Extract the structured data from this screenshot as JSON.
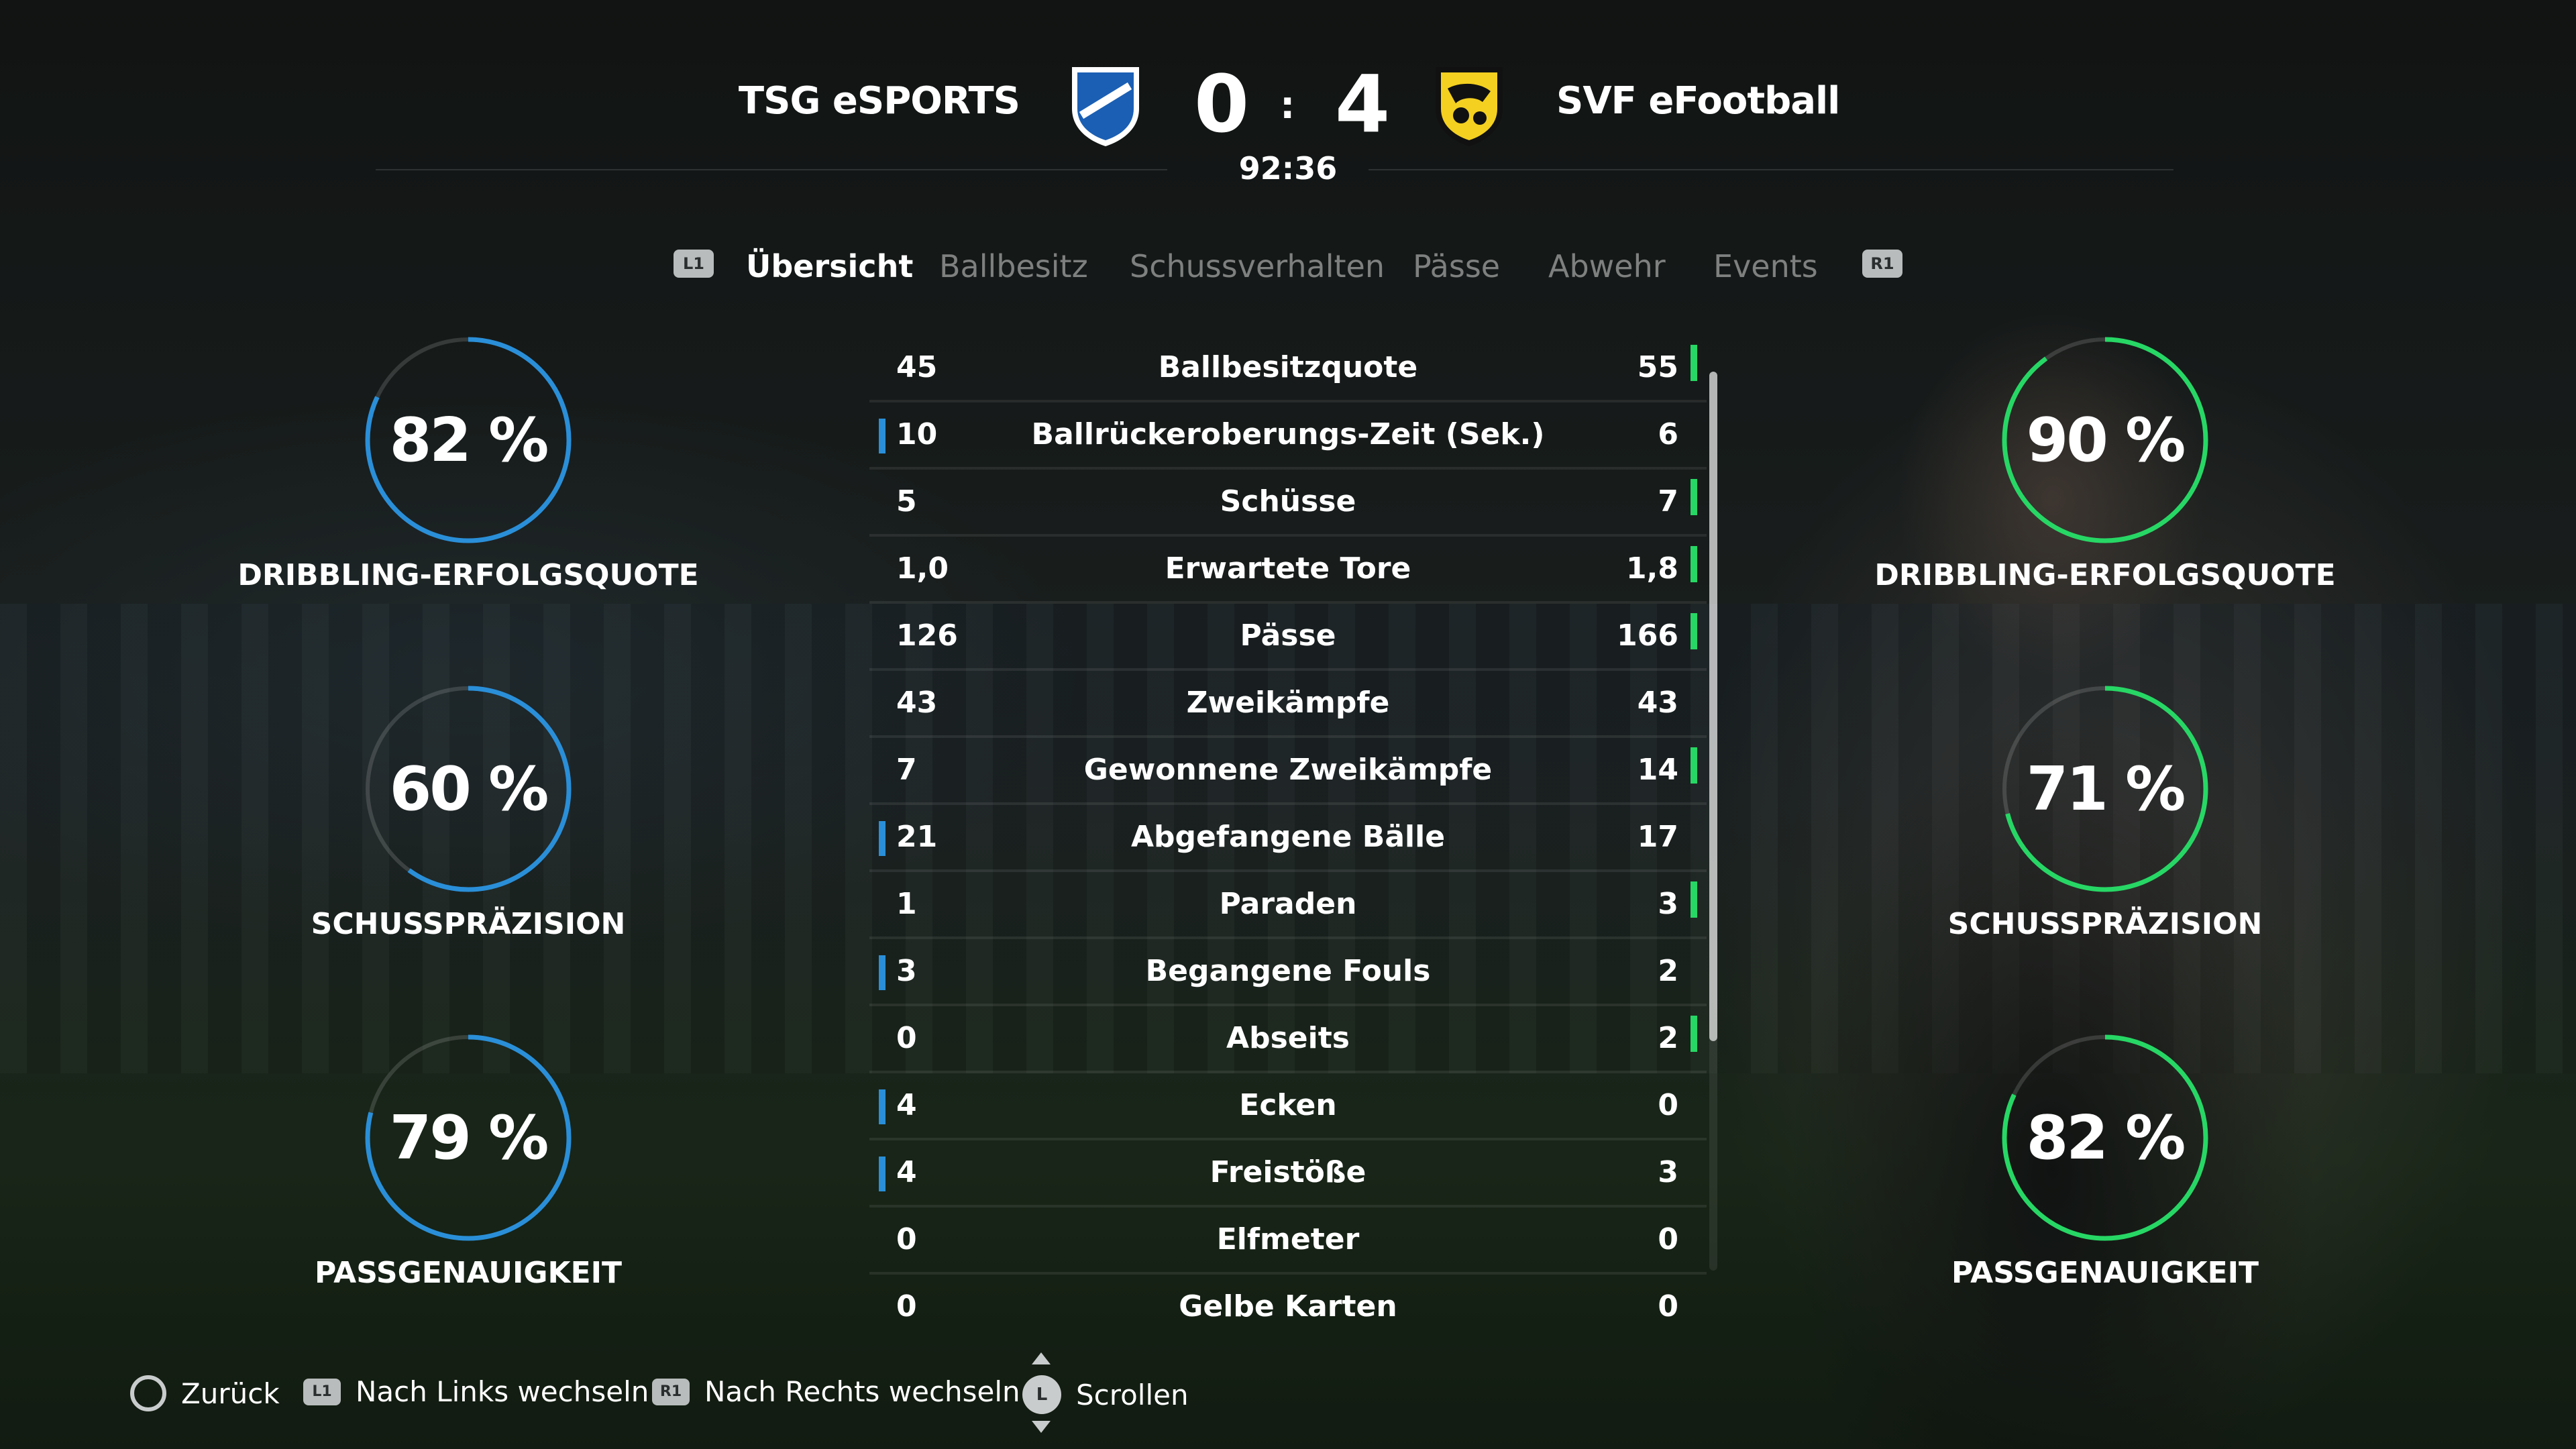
{
  "header": {
    "home_team": "TSG eSPORTS",
    "away_team": "SVF eFootball",
    "home_score": "0",
    "away_score": "4",
    "score_separator": ":",
    "match_time": "92:36"
  },
  "tabs": {
    "left_button": "L1",
    "right_button": "R1",
    "items": [
      {
        "label": "Übersicht",
        "active": true
      },
      {
        "label": "Ballbesitz",
        "active": false
      },
      {
        "label": "Schussverhalten",
        "active": false
      },
      {
        "label": "Pässe",
        "active": false
      },
      {
        "label": "Abwehr",
        "active": false
      },
      {
        "label": "Events",
        "active": false
      }
    ]
  },
  "home_gauges": [
    {
      "value": "82 %",
      "fraction": 0.82,
      "label": "DRIBBLING-ERFOLGSQUOTE"
    },
    {
      "value": "60 %",
      "fraction": 0.6,
      "label": "SCHUSSPRÄZISION"
    },
    {
      "value": "79 %",
      "fraction": 0.79,
      "label": "PASSGENAUIGKEIT"
    }
  ],
  "away_gauges": [
    {
      "value": "90 %",
      "fraction": 0.9,
      "label": "DRIBBLING-ERFOLGSQUOTE"
    },
    {
      "value": "71 %",
      "fraction": 0.71,
      "label": "SCHUSSPRÄZISION"
    },
    {
      "value": "82 %",
      "fraction": 0.82,
      "label": "PASSGENAUIGKEIT"
    }
  ],
  "stats": [
    {
      "home": "45",
      "label": "Ballbesitzquote",
      "away": "55",
      "leader": "away"
    },
    {
      "home": "10",
      "label": "Ballrückeroberungs-Zeit (Sek.)",
      "away": "6",
      "leader": "home"
    },
    {
      "home": "5",
      "label": "Schüsse",
      "away": "7",
      "leader": "away"
    },
    {
      "home": "1,0",
      "label": "Erwartete Tore",
      "away": "1,8",
      "leader": "away"
    },
    {
      "home": "126",
      "label": "Pässe",
      "away": "166",
      "leader": "away"
    },
    {
      "home": "43",
      "label": "Zweikämpfe",
      "away": "43",
      "leader": "none"
    },
    {
      "home": "7",
      "label": "Gewonnene Zweikämpfe",
      "away": "14",
      "leader": "away"
    },
    {
      "home": "21",
      "label": "Abgefangene Bälle",
      "away": "17",
      "leader": "home"
    },
    {
      "home": "1",
      "label": "Paraden",
      "away": "3",
      "leader": "away"
    },
    {
      "home": "3",
      "label": "Begangene Fouls",
      "away": "2",
      "leader": "home"
    },
    {
      "home": "0",
      "label": "Abseits",
      "away": "2",
      "leader": "away"
    },
    {
      "home": "4",
      "label": "Ecken",
      "away": "0",
      "leader": "home"
    },
    {
      "home": "4",
      "label": "Freistöße",
      "away": "3",
      "leader": "home"
    },
    {
      "home": "0",
      "label": "Elfmeter",
      "away": "0",
      "leader": "none"
    },
    {
      "home": "0",
      "label": "Gelbe Karten",
      "away": "0",
      "leader": "none"
    }
  ],
  "colors": {
    "home_accent": "#2a8fd8",
    "away_accent": "#27d765"
  },
  "footer": {
    "back_label": "Zurück",
    "left_button": "L1",
    "left_label": "Nach Links wechseln",
    "right_button": "R1",
    "right_label": "Nach Rechts wechseln",
    "stick_button": "L",
    "scroll_label": "Scrollen"
  }
}
